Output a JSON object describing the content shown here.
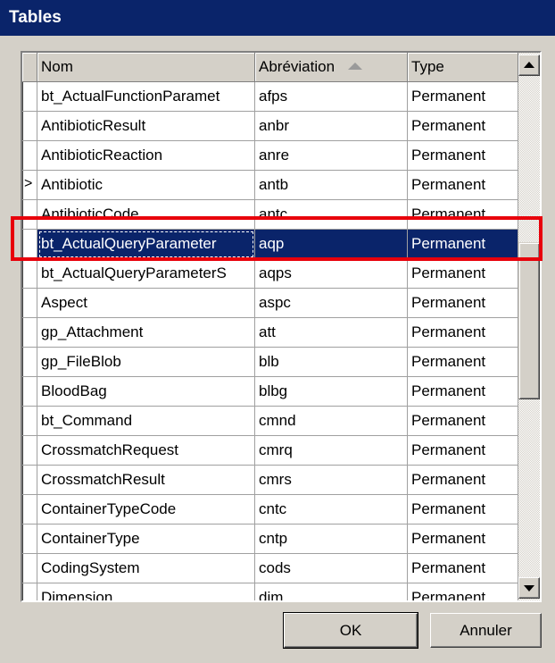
{
  "window": {
    "title": "Tables"
  },
  "table": {
    "columns": [
      {
        "label": "Nom"
      },
      {
        "label": "Abréviation",
        "sorted": "ascending"
      },
      {
        "label": "Type"
      }
    ],
    "rows": [
      {
        "marker": "",
        "nom": "bt_ActualFunctionParamet",
        "abr": "afps",
        "type": "Permanent"
      },
      {
        "marker": "",
        "nom": "AntibioticResult",
        "abr": "anbr",
        "type": "Permanent"
      },
      {
        "marker": "",
        "nom": "AntibioticReaction",
        "abr": "anre",
        "type": "Permanent"
      },
      {
        "marker": ">",
        "nom": "Antibiotic",
        "abr": "antb",
        "type": "Permanent"
      },
      {
        "marker": "",
        "nom": "AntibioticCode",
        "abr": "antc",
        "type": "Permanent"
      },
      {
        "marker": "",
        "nom": "bt_ActualQueryParameter",
        "abr": "aqp",
        "type": "Permanent",
        "selected": true
      },
      {
        "marker": "",
        "nom": "bt_ActualQueryParameterS",
        "abr": "aqps",
        "type": "Permanent"
      },
      {
        "marker": "",
        "nom": "Aspect",
        "abr": "aspc",
        "type": "Permanent"
      },
      {
        "marker": "",
        "nom": "gp_Attachment",
        "abr": "att",
        "type": "Permanent"
      },
      {
        "marker": "",
        "nom": "gp_FileBlob",
        "abr": "blb",
        "type": "Permanent"
      },
      {
        "marker": "",
        "nom": "BloodBag",
        "abr": "blbg",
        "type": "Permanent"
      },
      {
        "marker": "",
        "nom": "bt_Command",
        "abr": "cmnd",
        "type": "Permanent"
      },
      {
        "marker": "",
        "nom": "CrossmatchRequest",
        "abr": "cmrq",
        "type": "Permanent"
      },
      {
        "marker": "",
        "nom": "CrossmatchResult",
        "abr": "cmrs",
        "type": "Permanent"
      },
      {
        "marker": "",
        "nom": "ContainerTypeCode",
        "abr": "cntc",
        "type": "Permanent"
      },
      {
        "marker": "",
        "nom": "ContainerType",
        "abr": "cntp",
        "type": "Permanent"
      },
      {
        "marker": "",
        "nom": "CodingSystem",
        "abr": "cods",
        "type": "Permanent"
      },
      {
        "marker": "",
        "nom": "Dimension",
        "abr": "dim",
        "type": "Permanent"
      }
    ]
  },
  "buttons": {
    "ok": "OK",
    "cancel": "Annuler"
  },
  "colors": {
    "titlebar": "#0a246a",
    "selection": "#0a246a",
    "highlight": "#e8000b",
    "face": "#d4d0c8"
  },
  "icons": {
    "scroll_up": "triangle-up-icon",
    "scroll_down": "triangle-down-icon",
    "sort": "sort-ascending-icon"
  }
}
